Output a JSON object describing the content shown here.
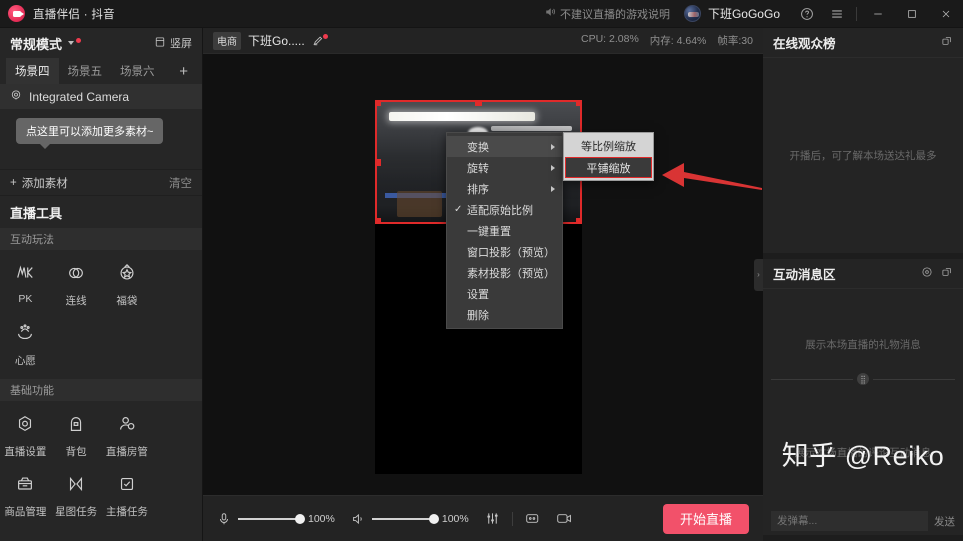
{
  "titlebar": {
    "app_title": "直播伴侣 · 抖音",
    "notice": "不建议直播的游戏说明",
    "user": "下班GoGoGo",
    "help_icon": "help-circle-icon",
    "menu_icon": "hamburger-menu-icon",
    "minimize": "—",
    "maximize": "▢",
    "close": "✕"
  },
  "sidebar": {
    "mode_label": "常规模式",
    "vertical_label": "竖屏",
    "tabs": [
      {
        "label": "场景四",
        "active": true
      },
      {
        "label": "场景五",
        "active": false
      },
      {
        "label": "场景六",
        "active": false
      }
    ],
    "add_tab": "+",
    "sources": [
      {
        "label": "Integrated Camera",
        "icon": "camera-icon"
      }
    ],
    "tooltip": "点这里可以添加更多素材~",
    "add_source": "添加素材",
    "clear": "清空",
    "tools_title": "直播工具",
    "sections": [
      {
        "title": "互动玩法",
        "items": [
          {
            "label": "PK",
            "icon": "pk-icon"
          },
          {
            "label": "连线",
            "icon": "link-icon"
          },
          {
            "label": "福袋",
            "icon": "gift-bag-icon"
          },
          {
            "label": "心愿",
            "icon": "wish-icon"
          }
        ]
      },
      {
        "title": "基础功能",
        "items": [
          {
            "label": "直播设置",
            "icon": "settings-icon"
          },
          {
            "label": "背包",
            "icon": "backpack-icon"
          },
          {
            "label": "直播房管",
            "icon": "room-admin-icon"
          },
          {
            "label": "商品管理",
            "icon": "product-icon"
          },
          {
            "label": "星图任务",
            "icon": "star-task-icon"
          },
          {
            "label": "主播任务",
            "icon": "anchor-task-icon"
          }
        ]
      }
    ]
  },
  "main": {
    "ecommerce_badge": "电商",
    "room_title": "下班Go.....",
    "edit_icon": "pencil-edit-icon",
    "stats": {
      "cpu": "CPU: 2.08%",
      "memory": "内存: 4.64%",
      "fps": "帧率:30"
    },
    "context_menu": {
      "items": [
        {
          "label": "变换",
          "submenu": true,
          "checked": false,
          "highlighted": true
        },
        {
          "label": "旋转",
          "submenu": true,
          "checked": false,
          "highlighted": false
        },
        {
          "label": "排序",
          "submenu": true,
          "checked": false,
          "highlighted": false
        },
        {
          "label": "适配原始比例",
          "submenu": false,
          "checked": true,
          "highlighted": false
        },
        {
          "label": "一键重置",
          "submenu": false,
          "checked": false,
          "highlighted": false
        },
        {
          "label": "窗口投影（预览）",
          "submenu": false,
          "checked": false,
          "highlighted": false
        },
        {
          "label": "素材投影（预览）",
          "submenu": false,
          "checked": false,
          "highlighted": false
        },
        {
          "label": "设置",
          "submenu": false,
          "checked": false,
          "highlighted": false
        },
        {
          "label": "删除",
          "submenu": false,
          "checked": false,
          "highlighted": false
        }
      ],
      "submenu": {
        "items": [
          {
            "label": "等比例缩放",
            "selected": false
          },
          {
            "label": "平铺缩放",
            "selected": true
          }
        ]
      }
    },
    "bottom_bar": {
      "mic_icon": "microphone-icon",
      "mic_level": "100%",
      "speaker_icon": "speaker-icon",
      "speaker_level": "100%",
      "mixer_icon": "audio-mixer-icon",
      "chat_icon": "screen-share-icon",
      "camera_icon": "camera-toggle-icon",
      "start_button": "开始直播"
    }
  },
  "right_panel": {
    "audience": {
      "title": "在线观众榜",
      "popout_icon": "popout-icon",
      "empty_text": "开播后，可了解本场送达礼最多"
    },
    "messages": {
      "title": "互动消息区",
      "settings_icon": "gear-icon",
      "popout_icon": "popout-icon",
      "gift_placeholder": "展示本场直播的礼物消息",
      "comment_placeholder": "展示本场直播的评论互动消息"
    },
    "watermark": "知乎 @Reiko",
    "message_input_placeholder": "发弹幕...",
    "send_label": "发送"
  },
  "colors": {
    "accent_red": "#f2516a",
    "selection_red": "#e02a2a",
    "arrow_red": "#d93434"
  }
}
